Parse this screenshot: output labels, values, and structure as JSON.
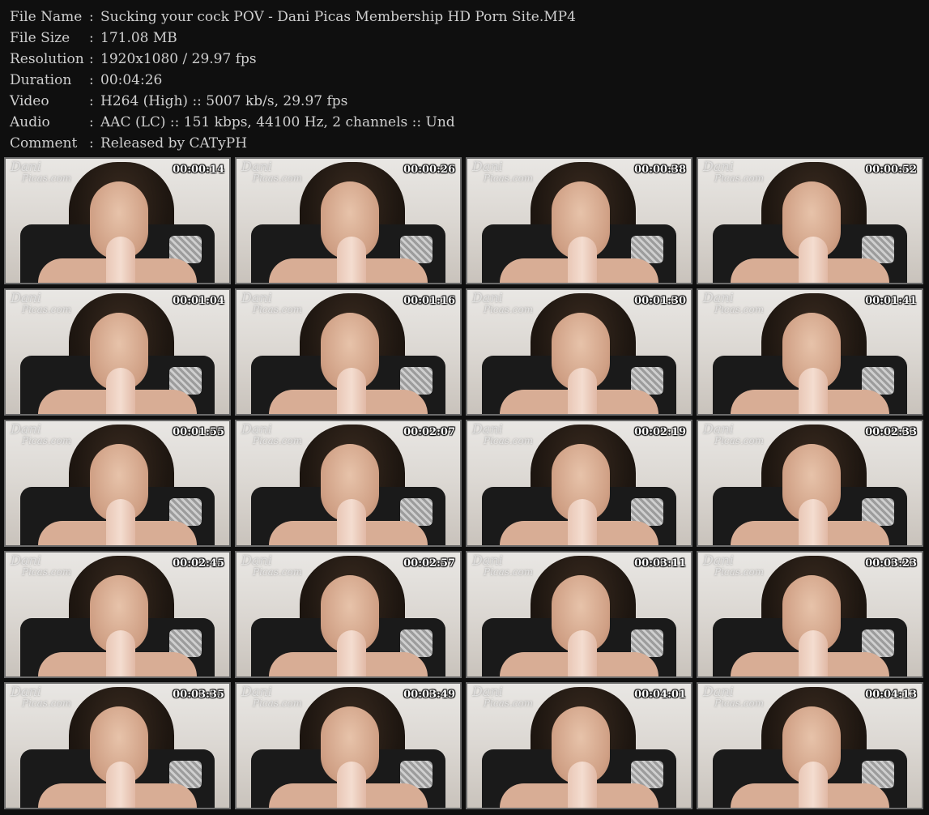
{
  "info": [
    {
      "label": "File Name",
      "sep": ":",
      "value": "Sucking your cock POV - Dani Picas Membership HD Porn Site.MP4"
    },
    {
      "label": "File Size",
      "sep": ":",
      "value": "171.08 MB"
    },
    {
      "label": "Resolution",
      "sep": ":",
      "value": "1920x1080 / 29.97 fps"
    },
    {
      "label": "Duration",
      "sep": ":",
      "value": "00:04:26"
    },
    {
      "label": "Video",
      "sep": ":",
      "value": "H264 (High) :: 5007 kb/s, 29.97 fps"
    },
    {
      "label": "Audio",
      "sep": ":",
      "value": "AAC (LC) :: 151 kbps, 44100 Hz, 2 channels :: Und"
    },
    {
      "label": "Comment",
      "sep": ":",
      "value": "Released by CATyPH"
    }
  ],
  "watermark": {
    "line1": "Dani",
    "line2": "Picas.com"
  },
  "thumbnails": [
    {
      "timestamp": "00:00:14"
    },
    {
      "timestamp": "00:00:26"
    },
    {
      "timestamp": "00:00:38"
    },
    {
      "timestamp": "00:00:52"
    },
    {
      "timestamp": "00:01:04"
    },
    {
      "timestamp": "00:01:16"
    },
    {
      "timestamp": "00:01:30"
    },
    {
      "timestamp": "00:01:41"
    },
    {
      "timestamp": "00:01:55"
    },
    {
      "timestamp": "00:02:07"
    },
    {
      "timestamp": "00:02:19"
    },
    {
      "timestamp": "00:02:33"
    },
    {
      "timestamp": "00:02:45"
    },
    {
      "timestamp": "00:02:57"
    },
    {
      "timestamp": "00:03:11"
    },
    {
      "timestamp": "00:03:23"
    },
    {
      "timestamp": "00:03:35"
    },
    {
      "timestamp": "00:03:49"
    },
    {
      "timestamp": "00:04:01"
    },
    {
      "timestamp": "00:04:13"
    }
  ]
}
